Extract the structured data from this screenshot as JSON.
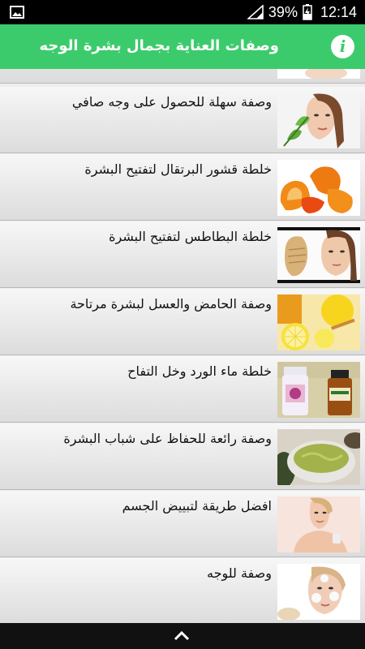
{
  "status_bar": {
    "battery_percent": "39%",
    "time": "12:14",
    "icons": [
      "image-icon",
      "signal-icon",
      "battery-charging-icon"
    ]
  },
  "app_bar": {
    "title": "وصفات العناية بجمال بشرة الوجه",
    "info_icon": "i"
  },
  "list": {
    "items": [
      {
        "label": "",
        "thumb": "face-woman"
      },
      {
        "label": "وصفة سهلة للحصول على وجه صافي",
        "thumb": "woman-leaves"
      },
      {
        "label": "خلطة قشور البرتقال لتفتيح البشرة",
        "thumb": "orange-peel"
      },
      {
        "label": "خلطة البطاطس لتفتيح البشرة",
        "thumb": "potato-woman"
      },
      {
        "label": "وصفة الحامض والعسل لبشرة مرتاحة",
        "thumb": "lemon-honey"
      },
      {
        "label": "خلطة ماء الورد وخل التفاح",
        "thumb": "bottles"
      },
      {
        "label": "وصفة رائعة للحفاظ على شباب البشرة",
        "thumb": "avocado-mask"
      },
      {
        "label": "افضل طريقة لتبييض الجسم",
        "thumb": "woman-cream"
      },
      {
        "label": "وصفة للوجه",
        "thumb": "woman-mask"
      }
    ]
  },
  "colors": {
    "accent": "#3ccb6c",
    "status_bar": "#000000",
    "bottom_bar": "#111111"
  }
}
